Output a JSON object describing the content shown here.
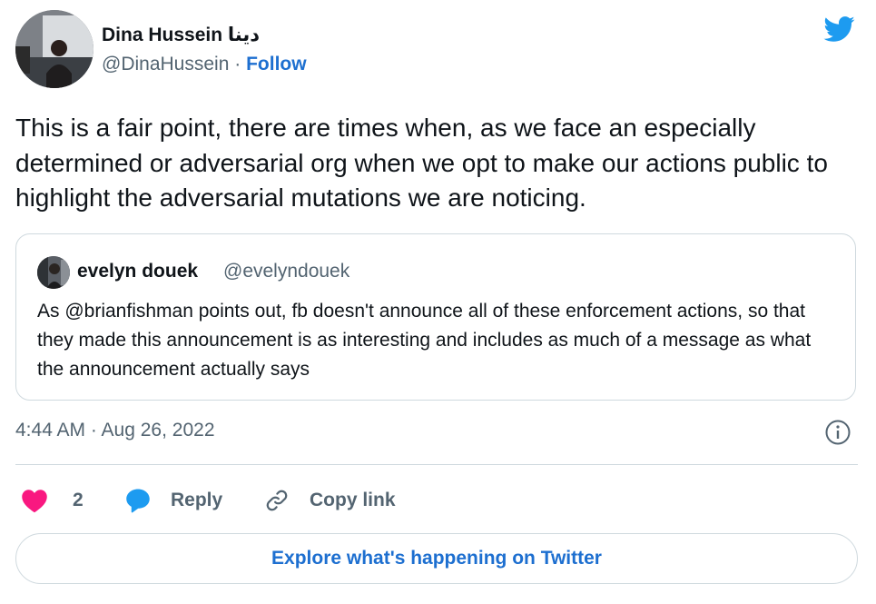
{
  "author": {
    "name": "Dina Hussein دينا",
    "handle": "@DinaHussein",
    "separator": "·",
    "follow_label": "Follow"
  },
  "tweet": {
    "text": "This is a fair point, there are times when, as we face an especially determined or adversarial org when we opt to make our actions public to highlight the adversarial mutations we are noticing.",
    "timestamp": "4:44 AM · Aug 26, 2022"
  },
  "quoted_tweet": {
    "name": "evelyn douek",
    "handle": "@evelyndouek",
    "text": "As @brianfishman points out, fb doesn't announce all of these enforcement actions, so that they made this announcement is as interesting and includes as much of a message as what the announcement actually says"
  },
  "actions": {
    "like_count": "2",
    "reply_label": "Reply",
    "copy_link_label": "Copy link"
  },
  "explore_label": "Explore what's happening on Twitter",
  "colors": {
    "brand_blue": "#1d9bf0",
    "link_blue": "#1d6fd0",
    "like_pink": "#f91880",
    "muted": "#536471",
    "border": "#cfd9de"
  },
  "icons": [
    "twitter-bird-icon",
    "info-icon",
    "heart-icon",
    "reply-bubble-icon",
    "link-icon"
  ]
}
